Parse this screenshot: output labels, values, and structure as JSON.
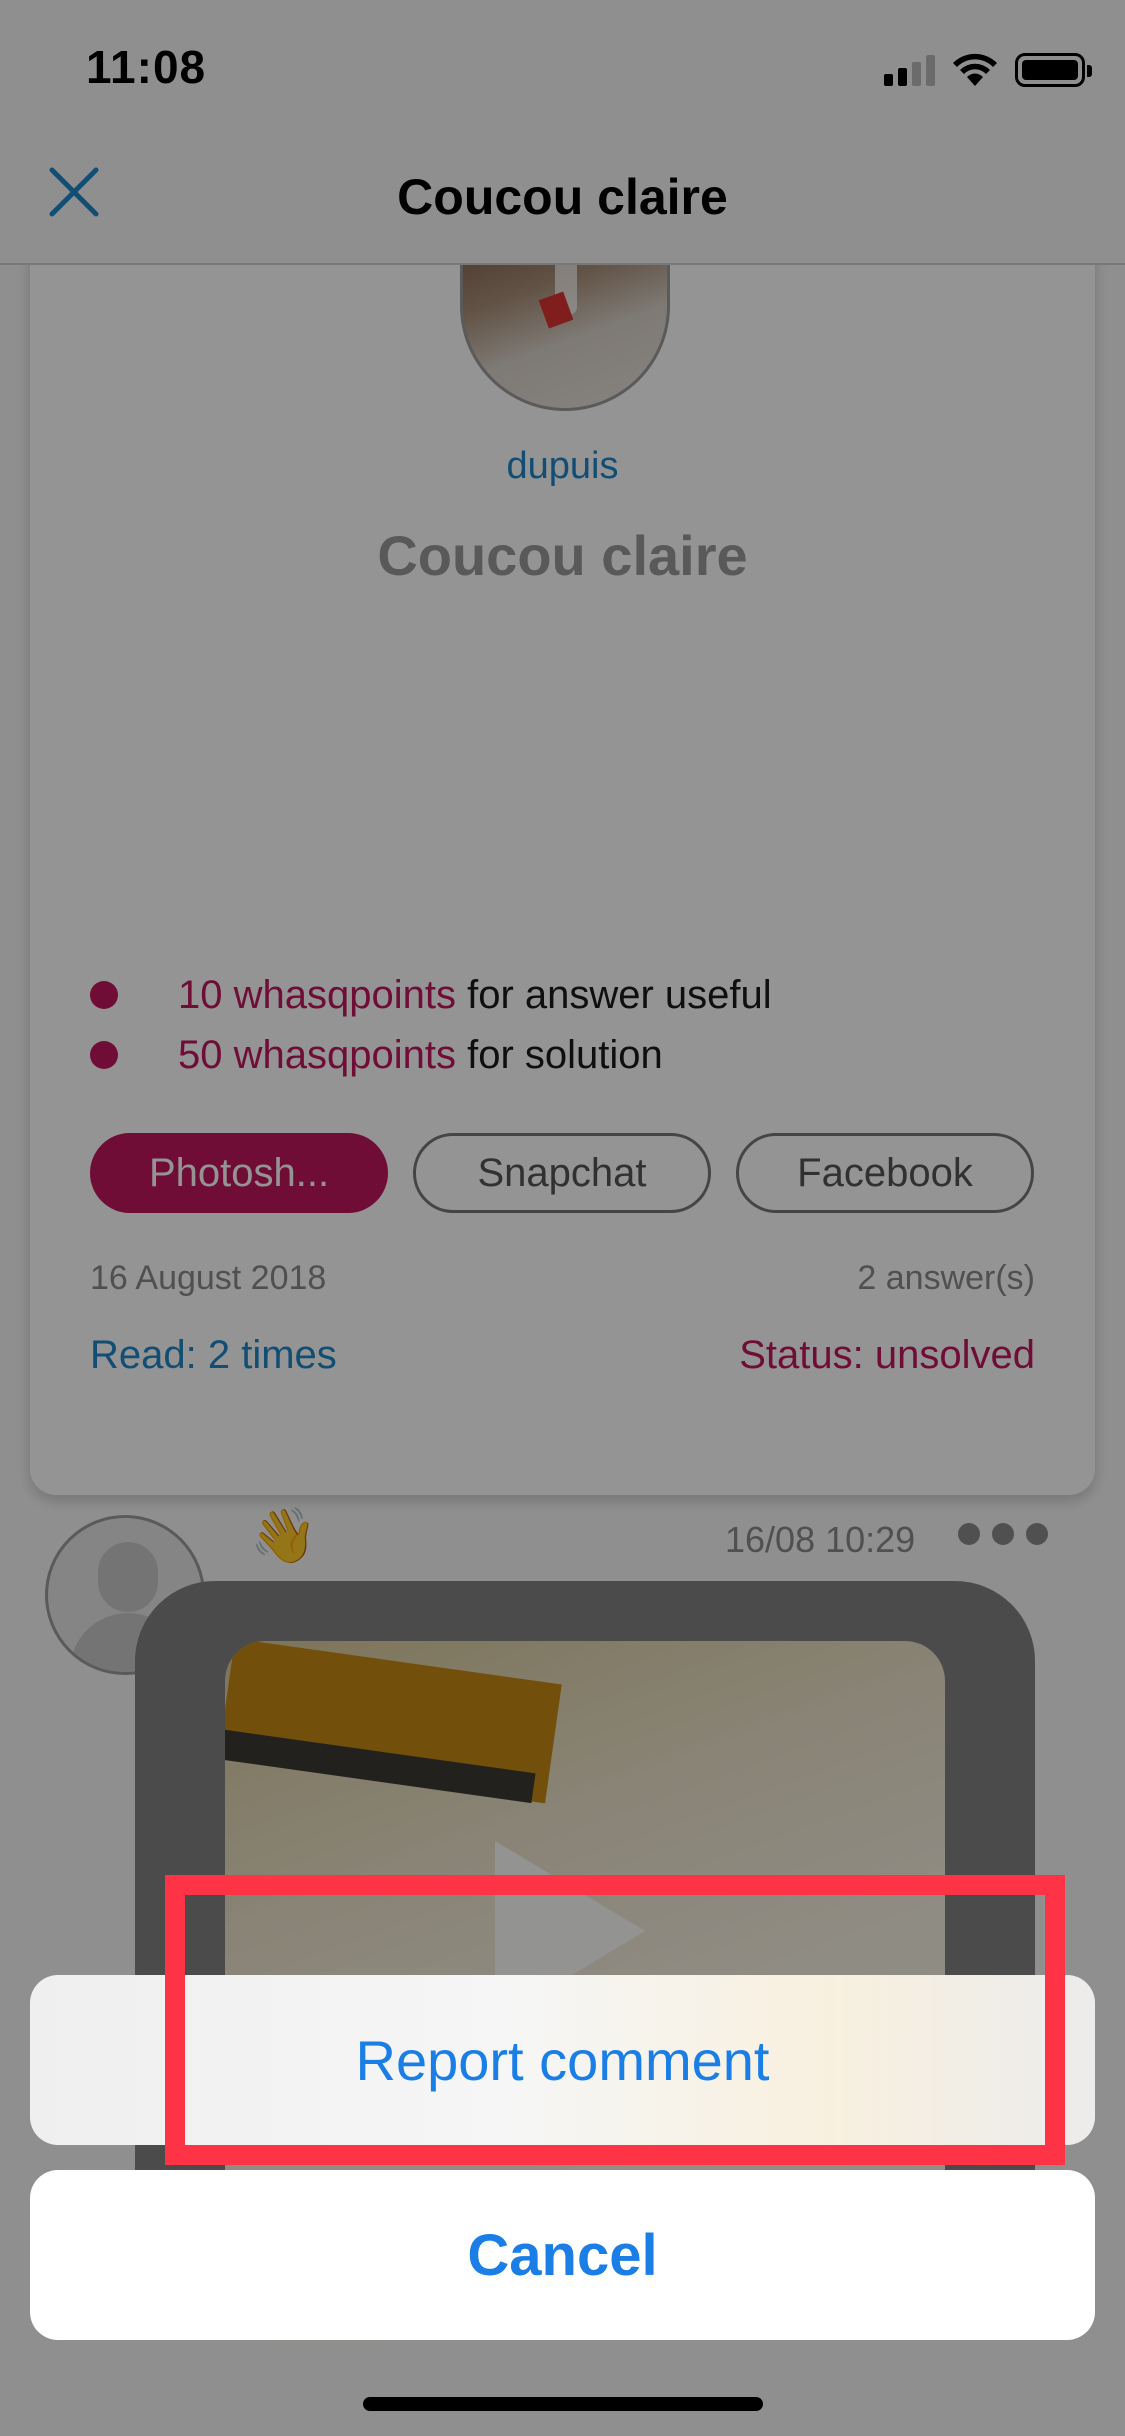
{
  "status_bar": {
    "time": "11:08"
  },
  "nav": {
    "title": "Coucou claire"
  },
  "question": {
    "author": "dupuis",
    "title": "Coucou claire",
    "points": [
      {
        "value": "10 whasqpoints",
        "text": " for answer useful"
      },
      {
        "value": "50 whasqpoints",
        "text": " for solution"
      }
    ],
    "tags": [
      "Photosh...",
      "Snapchat",
      "Facebook"
    ],
    "date": "16 August 2018",
    "answers": "2 answer(s)",
    "read": "Read: 2 times",
    "status": "Status: unsolved"
  },
  "comment": {
    "emoji": "👋",
    "time": "16/08 10:29"
  },
  "action_sheet": {
    "report_label": "Report comment",
    "cancel_label": "Cancel"
  },
  "colors": {
    "accent": "#1a7ee6",
    "brand": "#c0185f",
    "highlight": "#ff3346"
  }
}
